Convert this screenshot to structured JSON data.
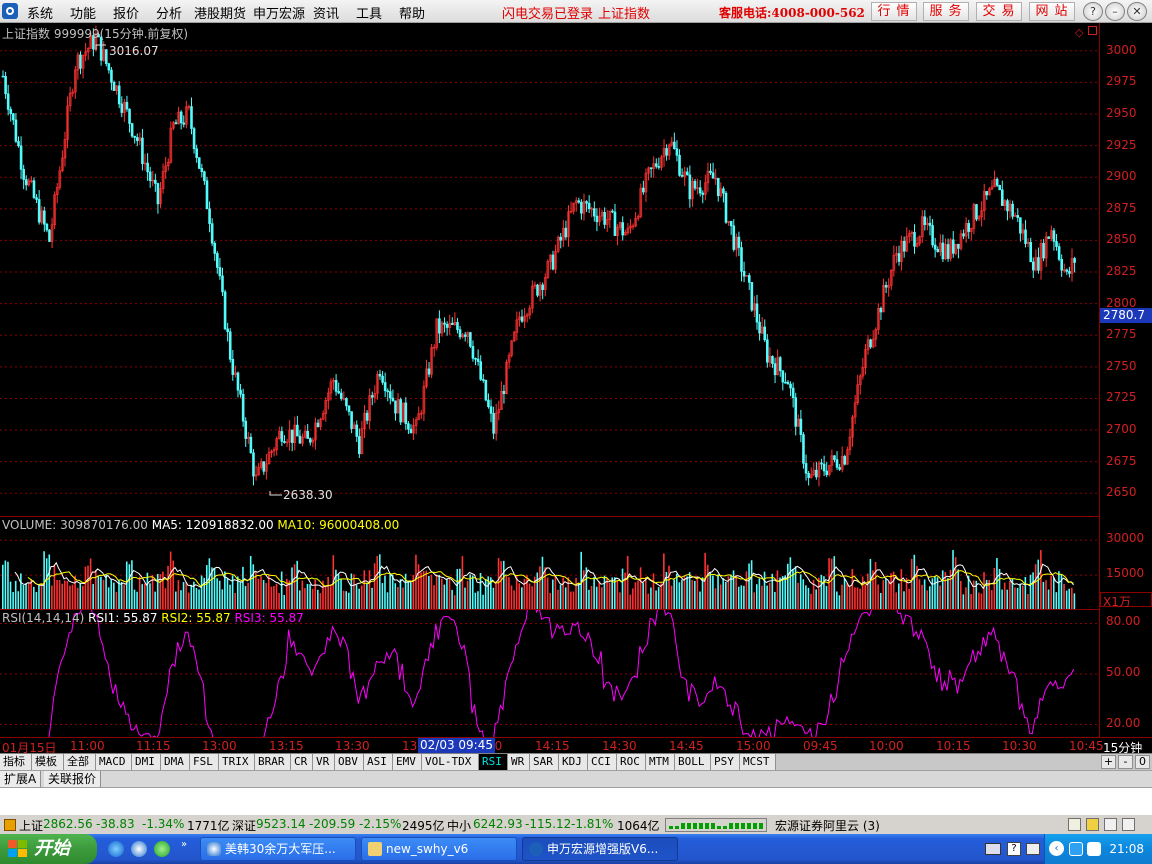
{
  "menubar": {
    "items": [
      "系统",
      "功能",
      "报价",
      "分析",
      "港股期货",
      "申万宏源",
      "资讯",
      "工具",
      "帮助"
    ],
    "login_status": "闪电交易已登录",
    "current_index": "上证指数",
    "hotline": "客服电话:4008-000-562",
    "nav_buttons": [
      "行情",
      "服务",
      "交易",
      "网站"
    ]
  },
  "price_pane": {
    "title": "上证指数 999999(15分钟.前复权)",
    "high_label": "3016.07",
    "low_label": "2638.30",
    "current_marker": "2780.7",
    "axis_labels": [
      "3000",
      "2975",
      "2950",
      "2925",
      "2900",
      "2875",
      "2850",
      "2825",
      "2800",
      "2775",
      "2750",
      "2725",
      "2700",
      "2675",
      "2650"
    ]
  },
  "volume_pane": {
    "label": "VOLUME: 309870176.00",
    "ma5": "MA5: 120918832.00",
    "ma10": "MA10: 96000408.00",
    "axis_labels": [
      "30000",
      "15000"
    ],
    "unit": "X1万"
  },
  "rsi_pane": {
    "label": "RSI(14,14,14)",
    "rsi1": "RSI1: 55.87",
    "rsi2": "RSI2: 55.87",
    "rsi3": "RSI3: 55.87",
    "axis_labels": [
      "80.00",
      "50.00",
      "20.00"
    ]
  },
  "time_axis": {
    "labels": [
      "01月15日",
      "11:00",
      "11:15",
      "13:00",
      "13:15",
      "13:30",
      "13",
      ":00",
      "14:15",
      "14:30",
      "14:45",
      "15:00",
      "09:45",
      "10:00",
      "10:15",
      "10:30",
      "10:45"
    ],
    "cursor_label": "02/03 09:45",
    "period": "15分钟"
  },
  "indicator_tabs": [
    "指标",
    "模板",
    "全部",
    "MACD",
    "DMI",
    "DMA",
    "FSL",
    "TRIX",
    "BRAR",
    "CR",
    "VR",
    "OBV",
    "ASI",
    "EMV",
    "VOL-TDX",
    "RSI",
    "WR",
    "SAR",
    "KDJ",
    "CCI",
    "ROC",
    "MTM",
    "BOLL",
    "PSY",
    "MCST"
  ],
  "active_indicator": "RSI",
  "tab_controls": [
    "+",
    "-",
    "0"
  ],
  "lower_tabs": [
    "扩展A",
    "关联报价"
  ],
  "statusbar": {
    "sh_name": "上证",
    "sh_value": "2862.56",
    "sh_change": "-38.83",
    "sh_pct": "-1.34%",
    "sh_amount": "1771亿",
    "sz_name": "深证",
    "sz_value": "9523.14",
    "sz_change": "-209.59",
    "sz_pct": "-2.15%",
    "sz_amount": "2495亿",
    "zx_name": "中小",
    "zx_value": "6242.93",
    "zx_change": "-115.12",
    "zx_pct": "-1.81%",
    "zx_amount": "1064亿",
    "broker": "宏源证券阿里云 (3)"
  },
  "taskbar": {
    "start_label": "开始",
    "tasks": [
      "美韩30余万大军压...",
      "new_swhy_v6",
      "申万宏源增强版V6..."
    ],
    "clock": "21:08"
  },
  "colors": {
    "up": "#ff3232",
    "down": "#54fcfc",
    "ma5": "#ffffff",
    "ma10": "#ffff00",
    "rsi": "#ff00ff",
    "axis": "#d02020"
  }
}
